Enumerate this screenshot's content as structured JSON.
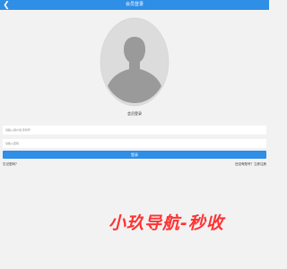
{
  "header": {
    "back_icon": "chevron-left-icon",
    "title": "会员登录"
  },
  "avatar": {
    "icon": "user-silhouette-icon"
  },
  "main": {
    "member_login_label": "会员登录",
    "username_placeholder": "请输入用户名/手机号",
    "password_placeholder": "请输入密码",
    "login_button_label": "登录",
    "forgot_password_label": "忘记密码？",
    "register_label": "还没有账号？立即注册"
  },
  "watermark": {
    "text": "小玖导航-秒收"
  },
  "colors": {
    "accent": "#2f8ee5",
    "background": "#f2f2f2",
    "watermark": "#ff3333"
  }
}
